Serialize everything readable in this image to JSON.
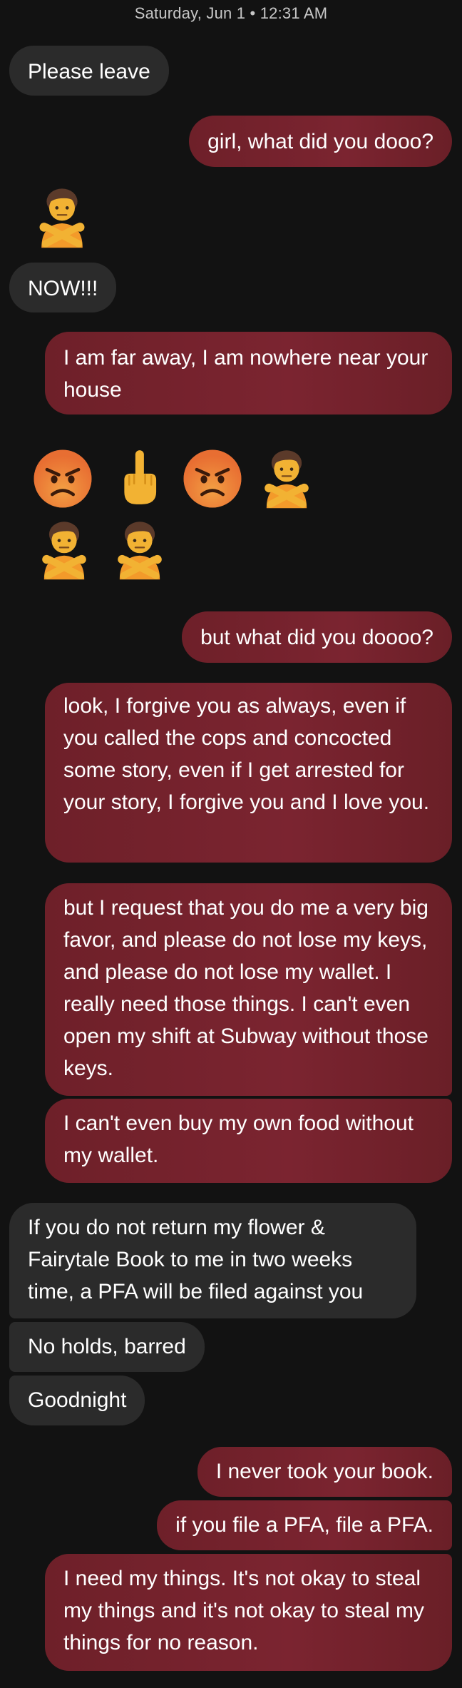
{
  "conversation": {
    "timestamp": "Saturday, Jun 1 • 12:31 AM",
    "messages": [
      {
        "from": "them",
        "text": "Please leave"
      },
      {
        "from": "me",
        "text": "girl, what did you dooo?"
      },
      {
        "from": "them",
        "emoji": [
          "person-gesturing-no"
        ]
      },
      {
        "from": "them",
        "text": "NOW!!!"
      },
      {
        "from": "me",
        "text": "I am far away, I am nowhere near your house"
      },
      {
        "from": "them",
        "emoji": [
          "angry-face",
          "middle-finger",
          "angry-face",
          "person-gesturing-no",
          "person-gesturing-no",
          "person-gesturing-no"
        ]
      },
      {
        "from": "me",
        "text": "but what did you doooo?"
      },
      {
        "from": "me",
        "text": "look, I forgive you as always, even if you called the cops and concocted some story, even if I get arrested for your story, I forgive you and I love you."
      },
      {
        "from": "me",
        "text": "but I request that you do me a very big favor, and please do not lose my keys, and please do not lose my wallet. I really need those things. I can't even open my shift at Subway without those keys."
      },
      {
        "from": "me",
        "text": "I can't even buy my own food without my wallet."
      },
      {
        "from": "them",
        "text": "If you do not return my flower & Fairytale Book to me in two weeks time, a PFA will be filed against you"
      },
      {
        "from": "them",
        "text": "No holds, barred"
      },
      {
        "from": "them",
        "text": "Goodnight"
      },
      {
        "from": "me",
        "text": "I never took your book."
      },
      {
        "from": "me",
        "text": "if you file a PFA, file a PFA."
      },
      {
        "from": "me",
        "text": "I need my things. It's not okay to steal my things and it's not okay to steal my things for no reason."
      }
    ]
  },
  "colors": {
    "background": "#121212",
    "incoming_bubble": "#2b2b2b",
    "outgoing_bubble": "#742230",
    "timestamp_text": "#c7c7c7"
  }
}
